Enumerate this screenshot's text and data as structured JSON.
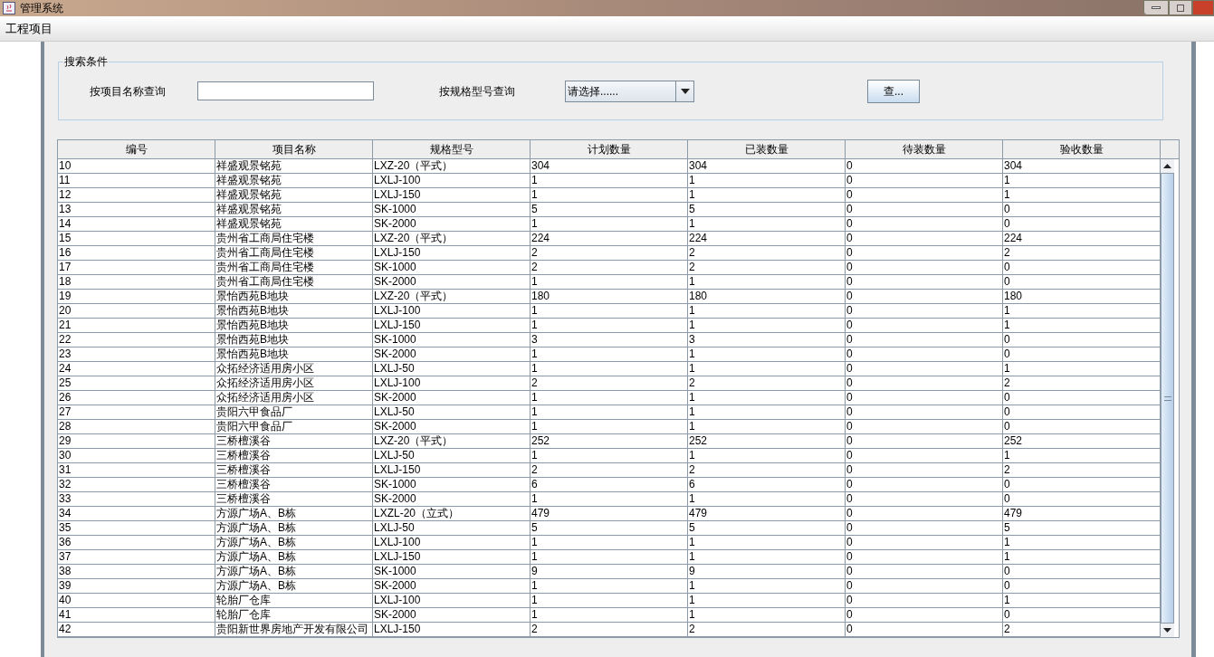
{
  "window": {
    "title": "管理系统"
  },
  "menu": [
    "工程项目"
  ],
  "search": {
    "legend": "搜索条件",
    "name_label": "按项目名称查询",
    "spec_label": "按规格型号查询",
    "spec_value": "请选择......",
    "button": "查..."
  },
  "table": {
    "columns": [
      "编号",
      "项目名称",
      "规格型号",
      "计划数量",
      "已装数量",
      "待装数量",
      "验收数量"
    ],
    "rows": [
      [
        "10",
        "祥盛观景铭苑",
        "LXZ-20（平式）",
        "304",
        "304",
        "0",
        "304"
      ],
      [
        "11",
        "祥盛观景铭苑",
        "LXLJ-100",
        "1",
        "1",
        "0",
        "1"
      ],
      [
        "12",
        "祥盛观景铭苑",
        "LXLJ-150",
        "1",
        "1",
        "0",
        "1"
      ],
      [
        "13",
        "祥盛观景铭苑",
        "SK-1000",
        "5",
        "5",
        "0",
        "0"
      ],
      [
        "14",
        "祥盛观景铭苑",
        "SK-2000",
        "1",
        "1",
        "0",
        "0"
      ],
      [
        "15",
        "贵州省工商局住宅楼",
        "LXZ-20（平式）",
        "224",
        "224",
        "0",
        "224"
      ],
      [
        "16",
        "贵州省工商局住宅楼",
        "LXLJ-150",
        "2",
        "2",
        "0",
        "2"
      ],
      [
        "17",
        "贵州省工商局住宅楼",
        "SK-1000",
        "2",
        "2",
        "0",
        "0"
      ],
      [
        "18",
        "贵州省工商局住宅楼",
        "SK-2000",
        "1",
        "1",
        "0",
        "0"
      ],
      [
        "19",
        "景怡西苑B地块",
        "LXZ-20（平式）",
        "180",
        "180",
        "0",
        "180"
      ],
      [
        "20",
        "景怡西苑B地块",
        "LXLJ-100",
        "1",
        "1",
        "0",
        "1"
      ],
      [
        "21",
        "景怡西苑B地块",
        "LXLJ-150",
        "1",
        "1",
        "0",
        "1"
      ],
      [
        "22",
        "景怡西苑B地块",
        "SK-1000",
        "3",
        "3",
        "0",
        "0"
      ],
      [
        "23",
        "景怡西苑B地块",
        "SK-2000",
        "1",
        "1",
        "0",
        "0"
      ],
      [
        "24",
        "众拓经济适用房小区",
        "LXLJ-50",
        "1",
        "1",
        "0",
        "1"
      ],
      [
        "25",
        "众拓经济适用房小区",
        "LXLJ-100",
        "2",
        "2",
        "0",
        "2"
      ],
      [
        "26",
        "众拓经济适用房小区",
        "SK-2000",
        "1",
        "1",
        "0",
        "0"
      ],
      [
        "27",
        "贵阳六甲食品厂",
        "LXLJ-50",
        "1",
        "1",
        "0",
        "0"
      ],
      [
        "28",
        "贵阳六甲食品厂",
        "SK-2000",
        "1",
        "1",
        "0",
        "0"
      ],
      [
        "29",
        "三桥檀溪谷",
        "LXZ-20（平式）",
        "252",
        "252",
        "0",
        "252"
      ],
      [
        "30",
        "三桥檀溪谷",
        "LXLJ-50",
        "1",
        "1",
        "0",
        "1"
      ],
      [
        "31",
        "三桥檀溪谷",
        "LXLJ-150",
        "2",
        "2",
        "0",
        "2"
      ],
      [
        "32",
        "三桥檀溪谷",
        "SK-1000",
        "6",
        "6",
        "0",
        "0"
      ],
      [
        "33",
        "三桥檀溪谷",
        "SK-2000",
        "1",
        "1",
        "0",
        "0"
      ],
      [
        "34",
        "方源广场A、B栋",
        "LXZL-20（立式）",
        "479",
        "479",
        "0",
        "479"
      ],
      [
        "35",
        "方源广场A、B栋",
        "LXLJ-50",
        "5",
        "5",
        "0",
        "5"
      ],
      [
        "36",
        "方源广场A、B栋",
        "LXLJ-100",
        "1",
        "1",
        "0",
        "1"
      ],
      [
        "37",
        "方源广场A、B栋",
        "LXLJ-150",
        "1",
        "1",
        "0",
        "1"
      ],
      [
        "38",
        "方源广场A、B栋",
        "SK-1000",
        "9",
        "9",
        "0",
        "0"
      ],
      [
        "39",
        "方源广场A、B栋",
        "SK-2000",
        "1",
        "1",
        "0",
        "0"
      ],
      [
        "40",
        "轮胎厂仓库",
        "LXLJ-100",
        "1",
        "1",
        "0",
        "1"
      ],
      [
        "41",
        "轮胎厂仓库",
        "SK-2000",
        "1",
        "1",
        "0",
        "0"
      ],
      [
        "42",
        "贵阳新世界房地产开发有限公司",
        "LXLJ-150",
        "2",
        "2",
        "0",
        "2"
      ]
    ]
  }
}
